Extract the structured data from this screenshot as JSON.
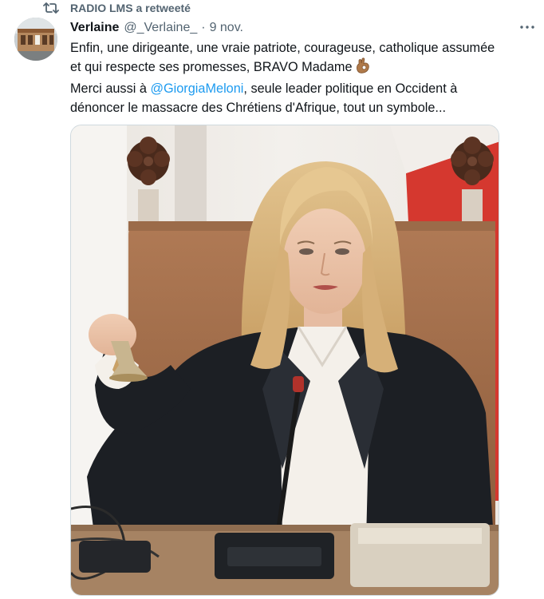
{
  "retweet": {
    "label": "RADIO LMS a retweeté",
    "icon": "retweet-icon"
  },
  "tweet": {
    "author_name": "Verlaine",
    "author_handle": "@_Verlaine_",
    "separator": "·",
    "date": "9 nov.",
    "text_line1": "Enfin, une dirigeante, une vraie patriote, courageuse, catholique assumée",
    "text_line2": "et qui respecte ses promesses, BRAVO Madame",
    "text_line3_prefix": "Merci aussi à ",
    "mention": "@GiorgiaMeloni",
    "text_line3_suffix": ", seule leader politique en Occident à",
    "text_line4": "dénoncer le massacre des Chrétiens d'Afrique, tout un symbole...",
    "emoji": "ok-hand-emoji",
    "more_icon": "more-options-icon"
  },
  "colors": {
    "text": "#0f1419",
    "secondary": "#536471",
    "link": "#1d9bf0"
  }
}
